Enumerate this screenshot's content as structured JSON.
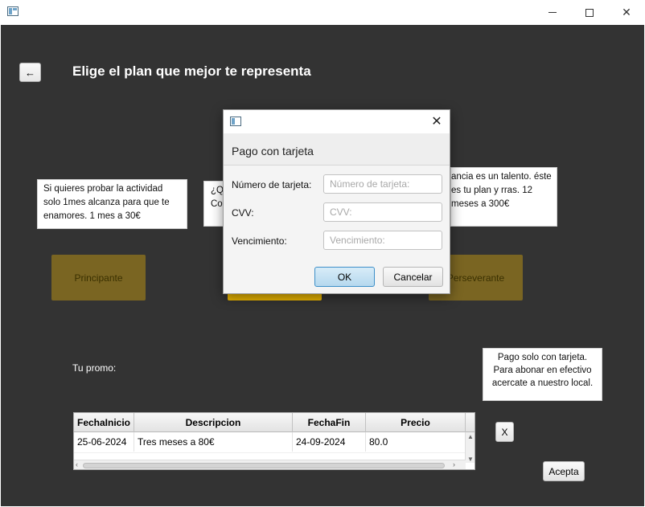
{
  "window": {
    "minimize_icon": "minimize-icon",
    "maximize_icon": "maximize-icon",
    "close_glyph": "✕"
  },
  "header": {
    "back_label": "←",
    "title": "Elige el plan que mejor te representa"
  },
  "plans": {
    "descriptions": [
      "Si quieres probar la actividad solo 1mes alcanza para que te enamores. 1 mes a 30€",
      "¿Qu Co",
      "ancia es un talento. éste es tu plan y rras. 12 meses a 300€"
    ],
    "principante_label": "Principante",
    "perseverante_label": "Perseverante",
    "accent_color": "#7a6522",
    "highlight_color": "#e8b400"
  },
  "promo": {
    "label": "Tu promo:",
    "note": "Pago solo con tarjeta. Para abonar en efectivo acercate a nuestro local."
  },
  "table": {
    "columns": [
      "FechaInicio",
      "Descripcion",
      "FechaFin",
      "Precio"
    ],
    "rows": [
      [
        "25-06-2024",
        "Tres meses a 80€",
        "24-09-2024",
        "80.0"
      ]
    ]
  },
  "actions": {
    "remove_label": "X",
    "accept_label": "Acepta"
  },
  "dialog": {
    "close_glyph": "✕",
    "heading": "Pago con tarjeta",
    "card_number_label": "Número de tarjeta:",
    "card_number_placeholder": "Número de tarjeta:",
    "cvv_label": "CVV:",
    "cvv_placeholder": "CVV:",
    "expiry_label": "Vencimiento:",
    "expiry_placeholder": "Vencimiento:",
    "ok_label": "OK",
    "cancel_label": "Cancelar"
  }
}
